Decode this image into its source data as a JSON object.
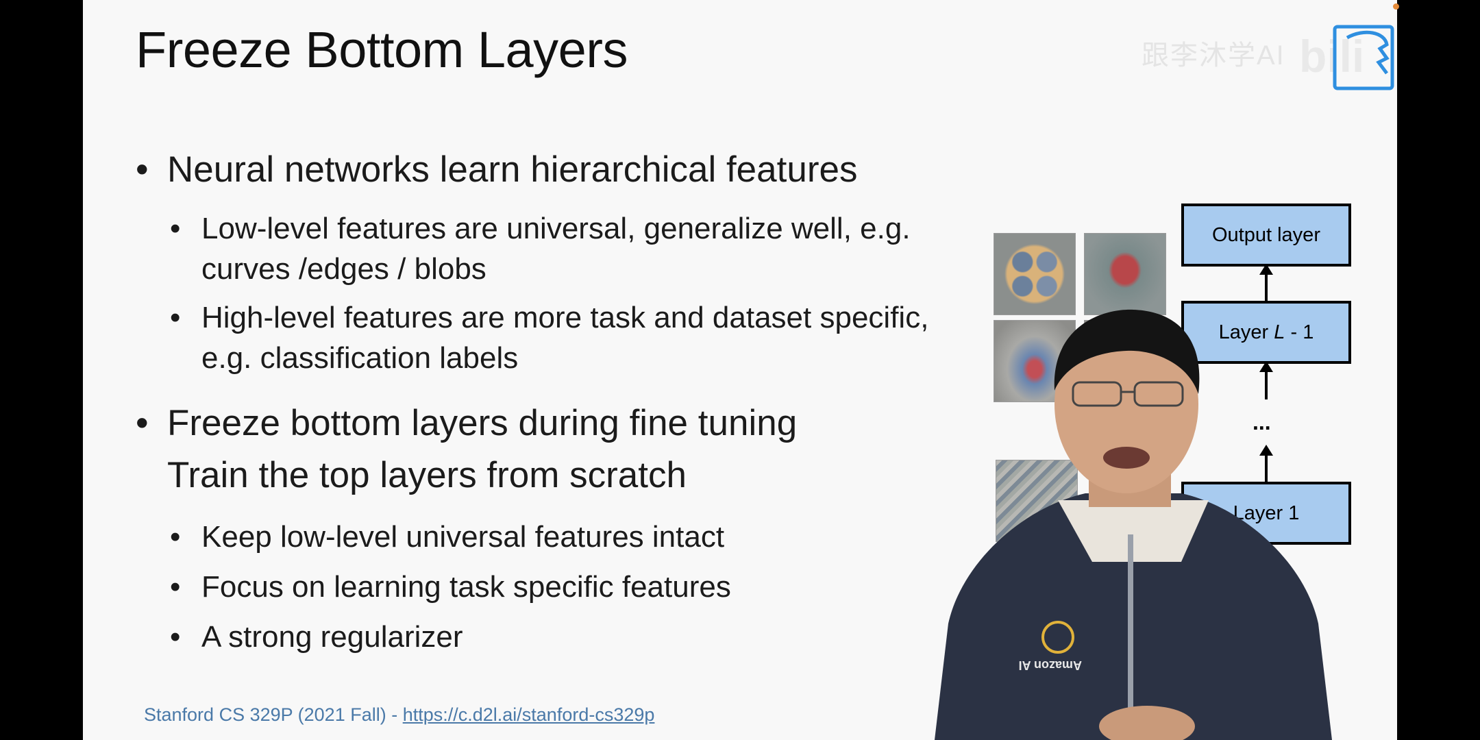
{
  "slide": {
    "title": "Freeze Bottom Layers",
    "bullets": {
      "b1": "Neural networks learn hierarchical features",
      "b1_1_line1": "Low-level features are universal, generalize well, e.g.",
      "b1_1_line2": "curves /edges / blobs",
      "b1_2_line1": "High-level features are more task and dataset specific,",
      "b1_2_line2": "e.g. classification labels",
      "b2_line1": "Freeze bottom layers during fine tuning",
      "b2_line2": "Train the top layers from scratch",
      "b2_1": "Keep low-level universal features intact",
      "b2_2": "Focus on learning task specific features",
      "b2_3": "A strong regularizer"
    },
    "bullet_glyph": "•",
    "footer": {
      "prefix": "Stanford CS 329P (2021 Fall) - ",
      "link": "https://c.d2l.ai/stanford-cs329p"
    }
  },
  "diagram": {
    "layers": [
      "Output layer",
      "Layer L - 1",
      "...",
      "Layer 1"
    ],
    "layer_output": "Output layer",
    "layer_l_prefix": "Layer ",
    "layer_l_italic": "L",
    "layer_l_suffix": " - 1",
    "ellipsis": "...",
    "layer_1": "Layer 1",
    "box_color": "#a8cbef"
  },
  "watermark": {
    "text": "跟李沐学AI"
  },
  "presenter": {
    "shirt_text": "Amazon AI"
  },
  "colors": {
    "footer_link": "#4a79a8",
    "title": "#111111",
    "slide_bg": "#f8f8f8"
  }
}
